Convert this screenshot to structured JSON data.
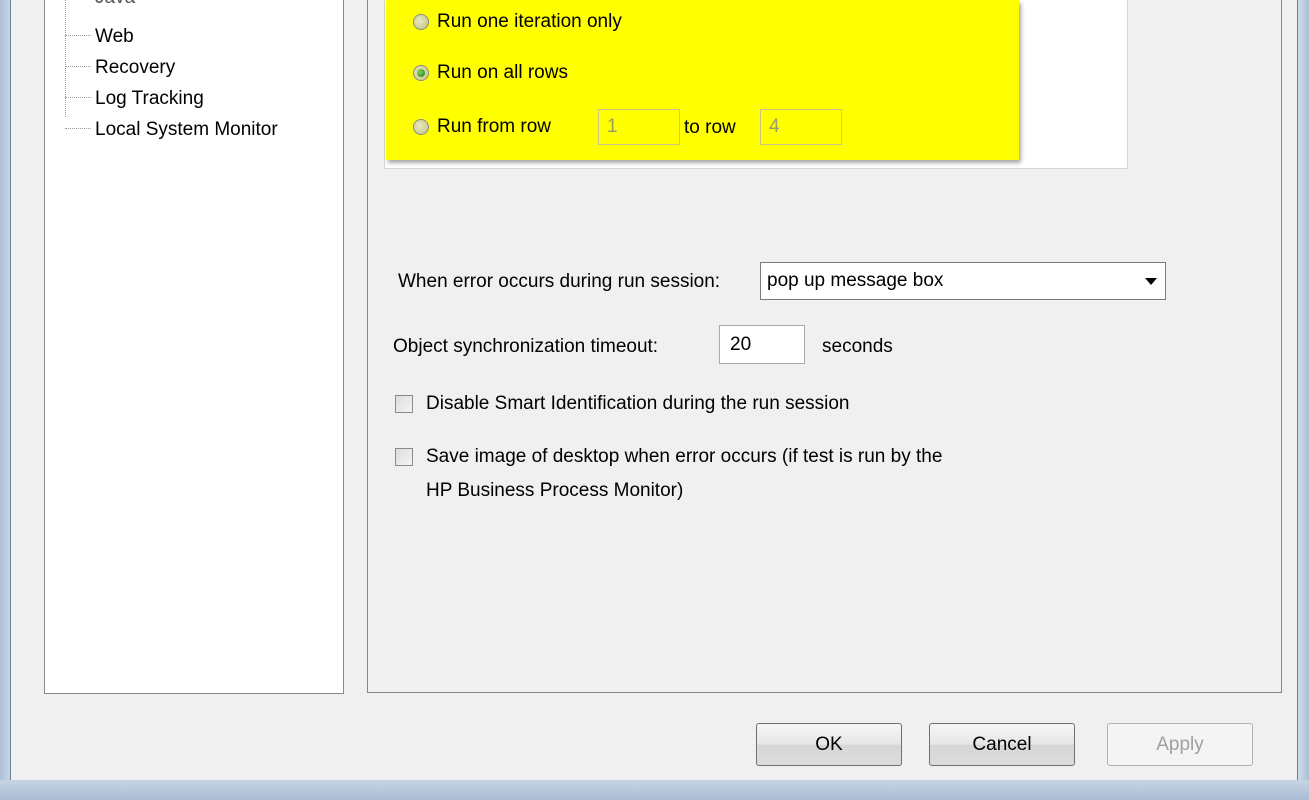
{
  "tree": {
    "items": [
      {
        "label": "Java"
      },
      {
        "label": "Web"
      },
      {
        "label": "Recovery"
      },
      {
        "label": "Log Tracking"
      },
      {
        "label": "Local System Monitor"
      }
    ]
  },
  "iterations": {
    "option_one": "Run one iteration only",
    "option_all": "Run on all rows",
    "option_range": "Run from row",
    "from_row_value": "1",
    "to_row_label": "to row",
    "to_row_value": "4",
    "selected": "Run on all rows"
  },
  "error_handling": {
    "label": "When error occurs during run session:",
    "selected_value": "pop up message box"
  },
  "sync": {
    "label": "Object synchronization timeout:",
    "value": "20",
    "unit": "seconds"
  },
  "checkboxes": {
    "disable_smart_id": "Disable Smart Identification during the run session",
    "save_image_line1": "Save image of desktop when error occurs (if test is run by the",
    "save_image_line2": "HP Business Process Monitor)"
  },
  "buttons": {
    "ok": "OK",
    "cancel": "Cancel",
    "apply": "Apply"
  },
  "colors": {
    "highlight": "#ffff00",
    "dialog_bg": "#f0f0f0",
    "frame": "#b9cbe0"
  }
}
